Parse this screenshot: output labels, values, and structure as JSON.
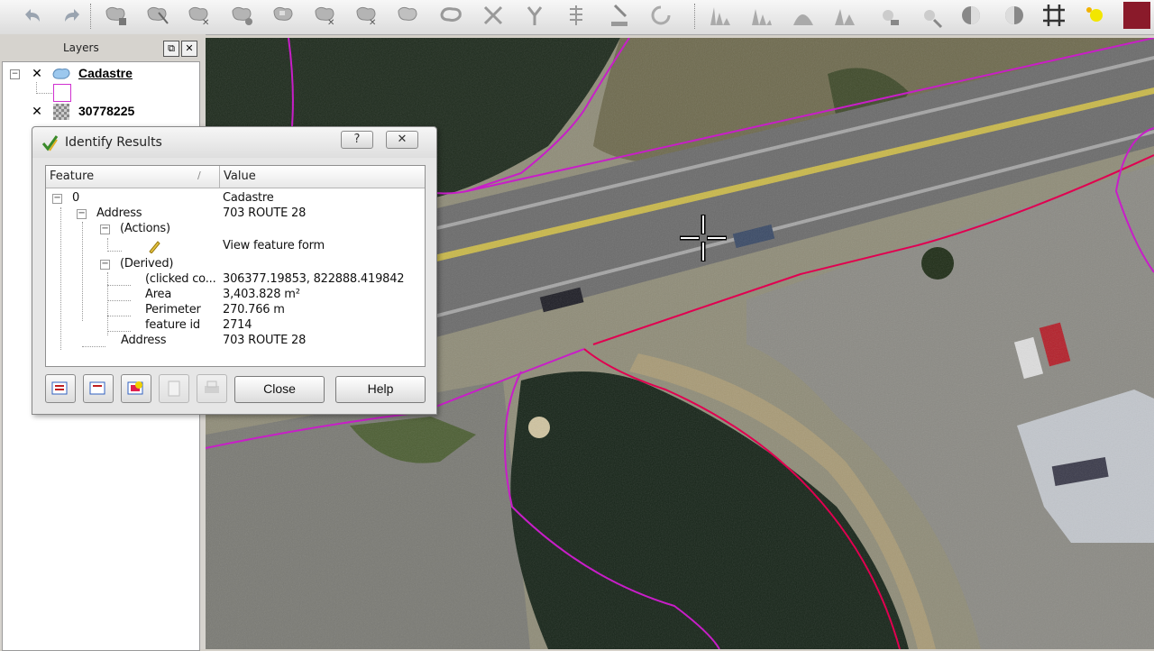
{
  "layers_panel": {
    "title": "Layers",
    "float_button": "⧉",
    "close_button": "✕",
    "items": [
      {
        "label": "Cadastre",
        "checked": true,
        "kind": "vector"
      },
      {
        "label": "30778225",
        "checked": true,
        "kind": "raster"
      }
    ]
  },
  "dialog": {
    "title": "Identify Results",
    "help_glyph": "?",
    "close_glyph": "✕",
    "columns": {
      "feature": "Feature",
      "value": "Value"
    },
    "rows": [
      {
        "feature": "0",
        "value": "Cadastre"
      },
      {
        "feature": "Address",
        "value": "703 ROUTE 28"
      },
      {
        "feature": "(Actions)",
        "value": ""
      },
      {
        "feature": "",
        "value": "View feature form"
      },
      {
        "feature": "(Derived)",
        "value": ""
      },
      {
        "feature": "(clicked co...",
        "value": "306377.19853, 822888.419842"
      },
      {
        "feature": "Area",
        "value": "3,403.828 m²"
      },
      {
        "feature": "Perimeter",
        "value": "270.766 m"
      },
      {
        "feature": "feature id",
        "value": "2714"
      },
      {
        "feature": "Address",
        "value": "703 ROUTE 28"
      }
    ],
    "close_label": "Close",
    "help_label": "Help"
  },
  "toolbar": {
    "tools": [
      "undo-icon",
      "redo-icon",
      "add-feature-icon",
      "move-feature-icon",
      "node-tool-icon",
      "delete-part-icon",
      "add-ring-icon",
      "delete-ring-icon",
      "add-part-icon",
      "reshape-icon",
      "offset-curve-icon",
      "split-feature-icon",
      "split-parts-icon",
      "merge-features-icon",
      "merge-attributes-icon",
      "rotate-point-icon",
      "raster-histogram-icon",
      "raster-stretch-icon",
      "raster-cumulative-icon",
      "raster-minmax-icon",
      "brightness-down-icon",
      "brightness-up-icon",
      "contrast-down-icon",
      "contrast-up-icon",
      "grid-icon",
      "highlight-icon"
    ]
  },
  "colors": {
    "parcel_outline": "#c81ec8",
    "parcel_outline_selected": "#e00050",
    "toolbar_bg": "#e6e6e6"
  }
}
